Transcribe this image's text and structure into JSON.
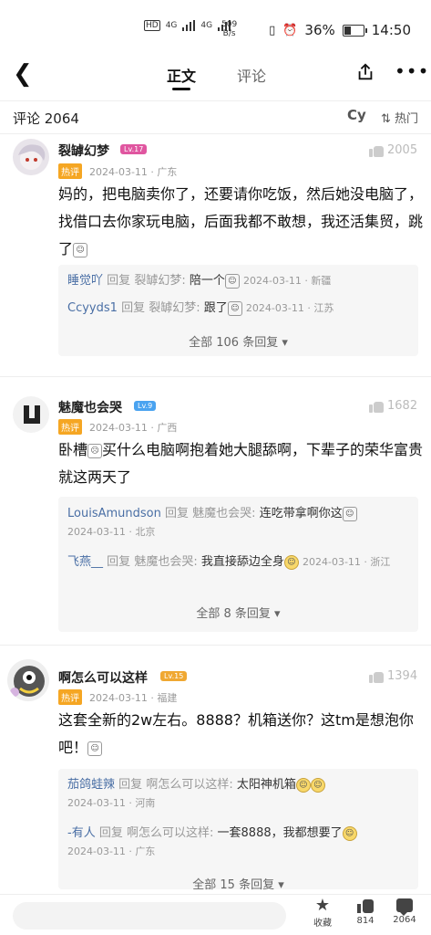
{
  "status": {
    "hd1": "HD",
    "hd2": "HD",
    "net1": "4G",
    "net2": "4G",
    "speed_value": "509",
    "speed_unit": "B/s",
    "battery": "36%",
    "time": "14:50"
  },
  "nav": {
    "tab_main": "正文",
    "tab_comment": "评论",
    "more": "•••"
  },
  "comments_header": {
    "count": "评论 2064",
    "cy": "Cy",
    "sort": "热门"
  },
  "comments": [
    {
      "name": "裂罅幻梦",
      "level": "Lv.17",
      "badge": "热评",
      "meta": "2024-03-11 · 广东",
      "likes": "2005",
      "text": "妈的，把电脑卖你了，还要请你吃饭，然后她没电脑了，找借口去你家玩电脑，后面我都不敢想，我还活集贸，跳了",
      "replies": [
        {
          "name": "睡觉吖",
          "mid": "回复",
          "target": "裂罅幻梦:",
          "text": "陪一个",
          "meta": "2024-03-11 · 新疆"
        },
        {
          "name": "Ccyyds1",
          "mid": "回复",
          "target": "裂罅幻梦:",
          "text": "跟了",
          "meta": "2024-03-11 · 江苏"
        }
      ],
      "more": "全部 106 条回复 ▾"
    },
    {
      "name": "魅魔也会哭",
      "level": "Lv.9",
      "badge": "热评",
      "meta": "2024-03-11 · 广西",
      "likes": "1682",
      "text": "卧槽",
      "text2": "买什么电脑啊抱着她大腿舔啊，下辈子的荣华富贵就这两天了",
      "replies": [
        {
          "name": "LouisAmundson",
          "mid": "回复",
          "target": "魅魔也会哭:",
          "text": "连吃带拿啊你这",
          "meta": "2024-03-11 · 北京"
        },
        {
          "name": "飞燕__",
          "mid": "回复",
          "target": "魅魔也会哭:",
          "text": "我直接舔边全身",
          "meta": "2024-03-11 · 浙江"
        }
      ],
      "more": "全部 8 条回复 ▾"
    },
    {
      "name": "啊怎么可以这样",
      "level": "Lv.15",
      "badge": "热评",
      "meta": "2024-03-11 · 福建",
      "likes": "1394",
      "text": "这套全新的2w左右。8888？机箱送你？这tm是想泡你吧！",
      "replies": [
        {
          "name": "茄鸽蛙辣",
          "mid": "回复",
          "target": "啊怎么可以这样:",
          "text": "太阳神机箱",
          "meta": "2024-03-11 · 河南"
        },
        {
          "name": "-有人",
          "mid": "回复",
          "target": "啊怎么可以这样:",
          "text": "一套8888，我都想要了",
          "meta": "2024-03-11 · 广东"
        }
      ],
      "more": "全部 15 条回复 ▾"
    }
  ],
  "bottom": {
    "fav": "收藏",
    "like_count": "814",
    "comment_count": "2064"
  },
  "colors": {
    "badge": "#f5a623",
    "lv17": "#e056a0",
    "lv9": "#4aa3f0",
    "lv15": "#f0a832",
    "reply_name": "#4a6fa5"
  }
}
